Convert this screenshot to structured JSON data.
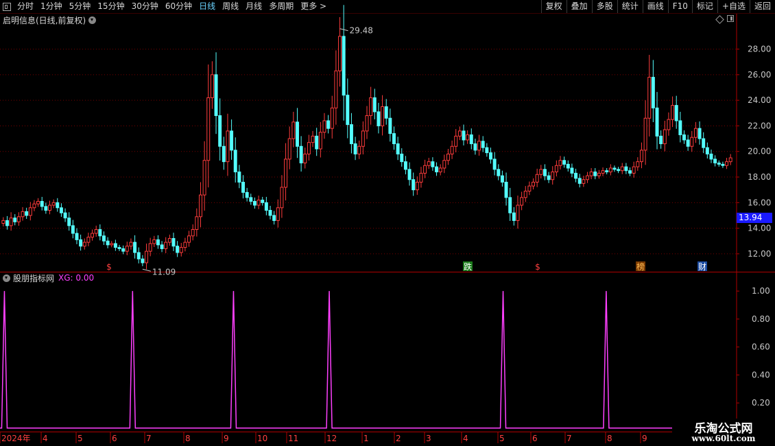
{
  "toolbar": {
    "periods": [
      "分时",
      "1分钟",
      "5分钟",
      "15分钟",
      "30分钟",
      "60分钟",
      "日线",
      "周线",
      "月线",
      "多周期",
      "更多 >"
    ],
    "active_period": "日线",
    "right_buttons": [
      "复权",
      "叠加",
      "多股",
      "统计",
      "画线",
      "F10",
      "标记",
      "+自选",
      "返回"
    ]
  },
  "main_chart": {
    "title": "启明信息(日线,前复权)",
    "high_label": "29.48",
    "low_label": "11.09",
    "current_price": "13.94"
  },
  "indicator": {
    "name": "股朋指标网",
    "value_text": "XG: 0.00"
  },
  "watermark": {
    "title": "乐淘公式网",
    "url": "www.60lt.com"
  },
  "colors": {
    "up": "#ff3c3c",
    "down": "#54ffff",
    "indicator_line": "#ff40ff",
    "grid": "#7a0000",
    "axis": "#b00000"
  },
  "chart_data": [
    {
      "type": "candlestick",
      "title": "启明信息(日线,前复权)",
      "y_ticks": [
        12.0,
        14.0,
        16.0,
        18.0,
        20.0,
        22.0,
        24.0,
        26.0,
        28.0
      ],
      "ylim": [
        10.6,
        29.8
      ],
      "x_ticks": [
        "2024年",
        "4",
        "5",
        "6",
        "7",
        "8",
        "9",
        "10",
        "11",
        "12",
        "1",
        "2",
        "3",
        "4",
        "5",
        "6",
        "7",
        "8",
        "9"
      ],
      "markers": [
        "$",
        "跌",
        "$",
        "榜",
        "财"
      ],
      "closes": [
        14.6,
        14.2,
        14.8,
        14.5,
        14.9,
        15.3,
        15.0,
        15.6,
        15.9,
        16.1,
        15.7,
        15.4,
        15.8,
        16.0,
        15.6,
        15.2,
        14.8,
        14.2,
        13.6,
        13.1,
        12.6,
        12.9,
        13.3,
        13.6,
        13.9,
        13.4,
        13.0,
        12.7,
        12.8,
        12.5,
        12.4,
        12.2,
        12.6,
        12.9,
        12.1,
        11.6,
        11.3,
        12.2,
        12.8,
        13.1,
        12.7,
        12.4,
        12.9,
        13.2,
        12.6,
        12.1,
        12.5,
        12.9,
        13.4,
        13.9,
        14.9,
        16.6,
        19.3,
        24.2,
        26.0,
        22.8,
        20.4,
        19.2,
        21.6,
        20.1,
        18.4,
        17.6,
        16.8,
        16.4,
        16.1,
        15.8,
        16.2,
        16.0,
        15.4,
        15.0,
        14.6,
        15.6,
        17.2,
        19.4,
        21.0,
        22.3,
        20.4,
        19.1,
        19.8,
        20.7,
        21.2,
        20.2,
        21.5,
        22.4,
        21.8,
        23.4,
        26.3,
        29.0,
        24.4,
        22.1,
        20.6,
        19.8,
        20.4,
        21.6,
        22.8,
        24.2,
        23.1,
        22.0,
        23.5,
        22.6,
        21.4,
        20.6,
        19.8,
        19.2,
        18.6,
        17.8,
        17.0,
        17.6,
        18.3,
        18.9,
        19.2,
        18.8,
        18.4,
        18.7,
        19.3,
        19.8,
        20.4,
        21.2,
        21.6,
        20.9,
        21.3,
        20.6,
        20.1,
        20.8,
        20.3,
        19.9,
        19.4,
        18.6,
        18.1,
        17.6,
        16.4,
        15.2,
        14.6,
        15.8,
        16.4,
        16.9,
        17.3,
        17.6,
        18.2,
        18.6,
        18.1,
        17.8,
        18.4,
        18.9,
        19.3,
        19.0,
        18.7,
        18.3,
        17.9,
        17.5,
        17.8,
        18.1,
        18.4,
        18.1,
        18.3,
        18.5,
        18.4,
        18.7,
        18.6,
        18.5,
        18.8,
        18.5,
        18.3,
        18.8,
        19.2,
        20.1,
        22.6,
        25.8,
        23.4,
        21.2,
        20.6,
        21.7,
        22.5,
        23.6,
        22.4,
        21.3,
        20.9,
        20.4,
        21.1,
        21.8,
        21.0,
        20.3,
        19.8,
        19.4,
        19.1,
        19.0,
        18.9,
        19.2,
        19.5
      ],
      "series": [
        {
          "name": "close",
          "source": "closes"
        }
      ]
    },
    {
      "type": "line",
      "series": [
        {
          "name": "XG",
          "spike_positions": [
            0.006,
            0.18,
            0.317,
            0.447,
            0.683,
            0.823
          ]
        }
      ],
      "y_ticks": [
        0.2,
        0.4,
        0.6,
        0.8,
        1.0
      ],
      "ylim": [
        0,
        1.05
      ]
    }
  ]
}
